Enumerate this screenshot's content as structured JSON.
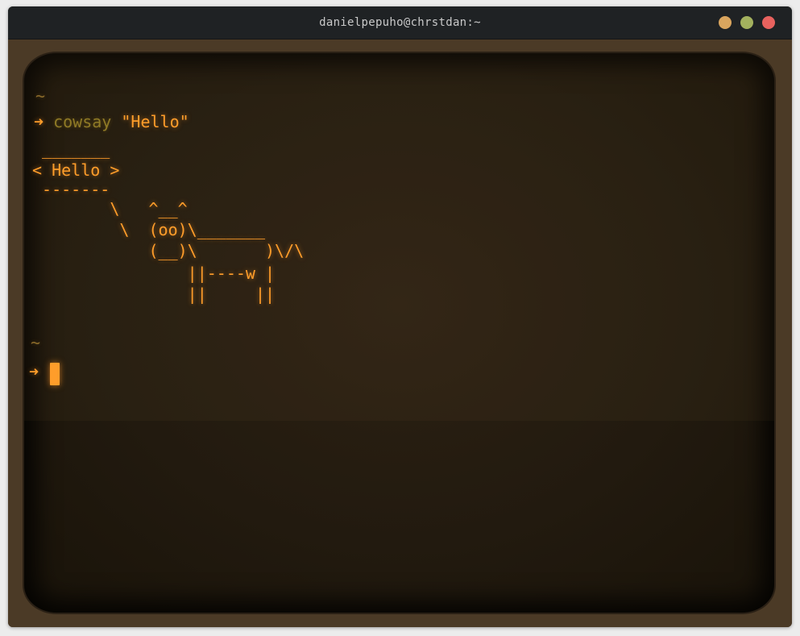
{
  "window": {
    "title": "danielpepuho@chrstdan:~"
  },
  "terminal": {
    "prompt_tilde_1": "~",
    "prompt_arrow_1": "➜",
    "command": "cowsay",
    "command_arg": "\"Hello\"",
    "output_lines": [
      " _______",
      "< Hello >",
      " -------",
      "        \\   ^__^",
      "         \\  (oo)\\_______",
      "            (__)\\       )\\/\\",
      "                ||----w |",
      "                ||     ||"
    ],
    "prompt_tilde_2": "~",
    "prompt_arrow_2": "➜"
  },
  "colors": {
    "phosphor": "#ff9d2a",
    "command": "#8f7a26",
    "titlebar": "#1f2224",
    "minimize": "#d9a55e",
    "maximize": "#a3b15e",
    "close": "#e8625e"
  }
}
